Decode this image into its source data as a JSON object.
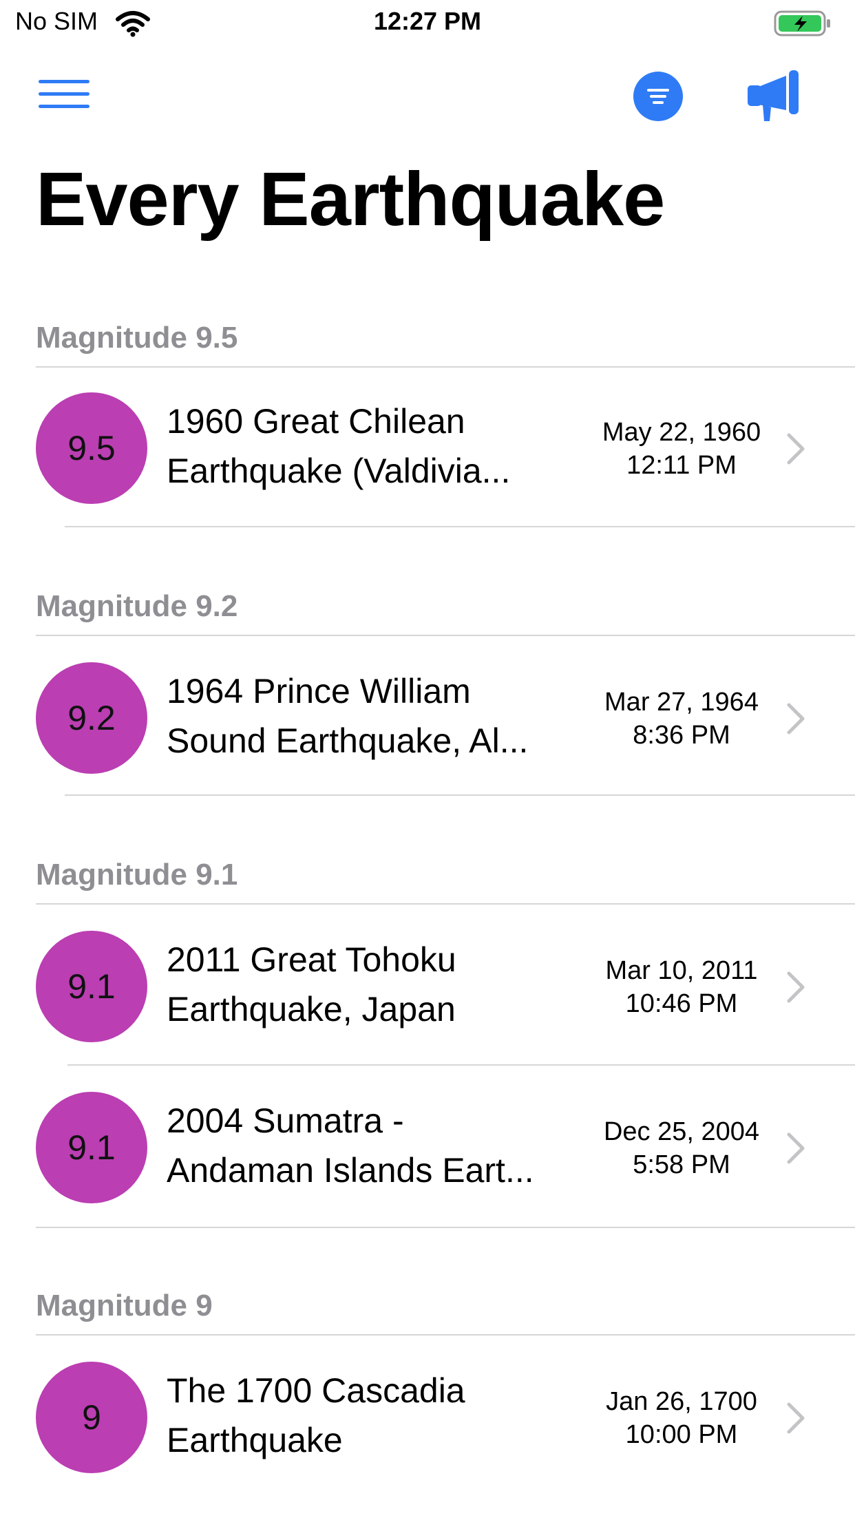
{
  "status_bar": {
    "carrier": "No SIM",
    "time": "12:27 PM",
    "battery_color": "#34c759"
  },
  "nav": {
    "menu_icon": "hamburger-menu-icon",
    "filter_icon": "filter-icon",
    "announce_icon": "megaphone-icon",
    "accent_color": "#2f7bf5"
  },
  "title": "Every Earthquake",
  "magnitude_color": "#bb3eb2",
  "sections": [
    {
      "header": "Magnitude 9.5",
      "items": [
        {
          "magnitude": "9.5",
          "name": "1960 Great Chilean\nEarthquake (Valdivia...",
          "date": "May 22, 1960\n12:11 PM"
        }
      ]
    },
    {
      "header": "Magnitude 9.2",
      "items": [
        {
          "magnitude": "9.2",
          "name": "1964 Prince William\nSound Earthquake, Al...",
          "date": "Mar 27, 1964\n8:36 PM"
        }
      ]
    },
    {
      "header": "Magnitude 9.1",
      "items": [
        {
          "magnitude": "9.1",
          "name": "2011 Great Tohoku\nEarthquake, Japan",
          "date": "Mar 10, 2011\n10:46 PM"
        },
        {
          "magnitude": "9.1",
          "name": "2004 Sumatra -\nAndaman Islands Eart...",
          "date": "Dec 25, 2004\n5:58 PM"
        }
      ]
    },
    {
      "header": "Magnitude 9",
      "items": [
        {
          "magnitude": "9",
          "name": "The 1700 Cascadia\nEarthquake",
          "date": "Jan 26, 1700\n10:00 PM"
        }
      ]
    }
  ]
}
